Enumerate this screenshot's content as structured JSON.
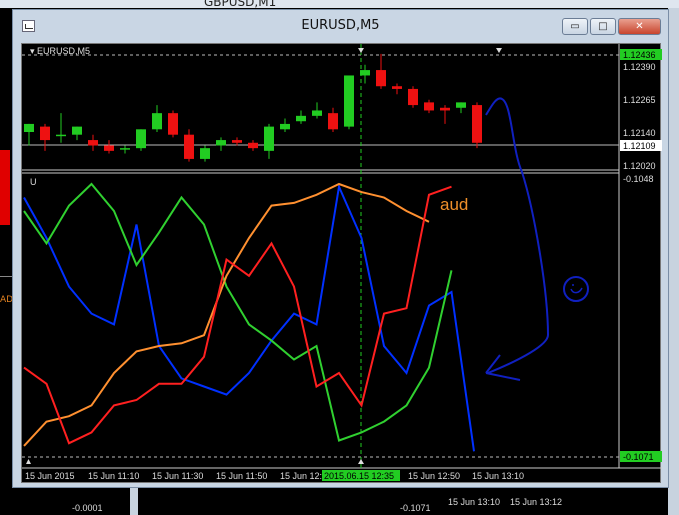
{
  "background": {
    "top_window_title": "GBPUSD,M1",
    "left_label": "AD",
    "bottom_labels": [
      "-0.0001",
      "-0.1071",
      "15 Jun 13:10",
      "15 Jun 13:12"
    ]
  },
  "window": {
    "title": "EURUSD,M5",
    "buttons": {
      "minimize": "▭",
      "maximize": "□",
      "close": "✕"
    }
  },
  "price_panel": {
    "symbol_label": "▾ EURUSD,M5",
    "price_axis": [
      "1.12390",
      "1.12265",
      "1.12140",
      "1.12020"
    ],
    "top_highlight": "1.12436",
    "current_price": "1.12109"
  },
  "indicator_panel": {
    "label": "U",
    "top_value": "-0.1048",
    "bottom_highlight": "-0.1071",
    "annotation": "aud",
    "series": [
      {
        "color": "#0030ff",
        "values": [
          0.95,
          0.8,
          0.62,
          0.52,
          0.48,
          0.85,
          0.4,
          0.28,
          0.25,
          0.22,
          0.3,
          0.42,
          0.52,
          0.48,
          0.99,
          0.8,
          0.4,
          0.3,
          0.55,
          0.6,
          0.01
        ]
      },
      {
        "color": "#30d030",
        "values": [
          0.9,
          0.78,
          0.92,
          1.0,
          0.9,
          0.7,
          0.82,
          0.95,
          0.85,
          0.62,
          0.48,
          0.42,
          0.35,
          0.4,
          0.05,
          0.08,
          0.12,
          0.18,
          0.32,
          0.68
        ]
      },
      {
        "color": "#ff9030",
        "values": [
          0.03,
          0.12,
          0.14,
          0.18,
          0.3,
          0.38,
          0.4,
          0.41,
          0.44,
          0.66,
          0.8,
          0.92,
          0.93,
          0.96,
          1.0,
          0.97,
          0.95,
          0.9,
          0.86
        ]
      },
      {
        "color": "#ff2020",
        "values": [
          0.32,
          0.26,
          0.04,
          0.08,
          0.18,
          0.2,
          0.26,
          0.26,
          0.36,
          0.72,
          0.66,
          0.78,
          0.62,
          0.25,
          0.3,
          0.18,
          0.52,
          0.54,
          0.96,
          0.99
        ]
      }
    ]
  },
  "time_axis": {
    "labels": [
      "15 Jun 2015",
      "15 Jun 11:10",
      "15 Jun 11:30",
      "15 Jun 11:50",
      "15 Jun 12:",
      "15 Jun 12:50",
      "15 Jun 13:10"
    ],
    "crosshair_time": "2015.06.15 12:35"
  },
  "candles": [
    {
      "o": 1.1215,
      "h": 1.1218,
      "l": 1.121,
      "c": 1.1218
    },
    {
      "o": 1.1217,
      "h": 1.1218,
      "l": 1.1208,
      "c": 1.1212
    },
    {
      "o": 1.1214,
      "h": 1.1222,
      "l": 1.1211,
      "c": 1.1214
    },
    {
      "o": 1.1214,
      "h": 1.1217,
      "l": 1.1212,
      "c": 1.1217
    },
    {
      "o": 1.1212,
      "h": 1.1214,
      "l": 1.1208,
      "c": 1.121
    },
    {
      "o": 1.121,
      "h": 1.1212,
      "l": 1.1207,
      "c": 1.1208
    },
    {
      "o": 1.1209,
      "h": 1.121,
      "l": 1.1207,
      "c": 1.1209
    },
    {
      "o": 1.1209,
      "h": 1.1216,
      "l": 1.1208,
      "c": 1.1216
    },
    {
      "o": 1.1216,
      "h": 1.1225,
      "l": 1.1215,
      "c": 1.1222
    },
    {
      "o": 1.1222,
      "h": 1.1223,
      "l": 1.1213,
      "c": 1.1214
    },
    {
      "o": 1.1214,
      "h": 1.1216,
      "l": 1.1204,
      "c": 1.1205
    },
    {
      "o": 1.1205,
      "h": 1.121,
      "l": 1.1204,
      "c": 1.1209
    },
    {
      "o": 1.121,
      "h": 1.1213,
      "l": 1.1208,
      "c": 1.1212
    },
    {
      "o": 1.1212,
      "h": 1.1213,
      "l": 1.121,
      "c": 1.1211
    },
    {
      "o": 1.1211,
      "h": 1.1212,
      "l": 1.1208,
      "c": 1.1209
    },
    {
      "o": 1.1208,
      "h": 1.1218,
      "l": 1.1205,
      "c": 1.1217
    },
    {
      "o": 1.1216,
      "h": 1.122,
      "l": 1.1215,
      "c": 1.1218
    },
    {
      "o": 1.1219,
      "h": 1.1223,
      "l": 1.1218,
      "c": 1.1221
    },
    {
      "o": 1.1221,
      "h": 1.1226,
      "l": 1.122,
      "c": 1.1223
    },
    {
      "o": 1.1222,
      "h": 1.1224,
      "l": 1.1215,
      "c": 1.1216
    },
    {
      "o": 1.1217,
      "h": 1.1236,
      "l": 1.1216,
      "c": 1.1236
    },
    {
      "o": 1.1236,
      "h": 1.124,
      "l": 1.1233,
      "c": 1.1238
    },
    {
      "o": 1.1238,
      "h": 1.1244,
      "l": 1.1231,
      "c": 1.1232
    },
    {
      "o": 1.1232,
      "h": 1.1233,
      "l": 1.1229,
      "c": 1.1231
    },
    {
      "o": 1.1231,
      "h": 1.1232,
      "l": 1.1224,
      "c": 1.1225
    },
    {
      "o": 1.1226,
      "h": 1.1227,
      "l": 1.1222,
      "c": 1.1223
    },
    {
      "o": 1.1224,
      "h": 1.1225,
      "l": 1.1218,
      "c": 1.1223
    },
    {
      "o": 1.1224,
      "h": 1.1226,
      "l": 1.1222,
      "c": 1.1226
    },
    {
      "o": 1.1225,
      "h": 1.1226,
      "l": 1.1209,
      "c": 1.1211
    }
  ],
  "colors": {
    "bull": "#22cc22",
    "bear": "#ee1111",
    "grid": "#bbbbbb",
    "highlight": "#22cc22",
    "drawing": "#1020c0"
  },
  "drawing_icons": [
    "pen-stroke-arrow-icon",
    "smiley-icon"
  ]
}
